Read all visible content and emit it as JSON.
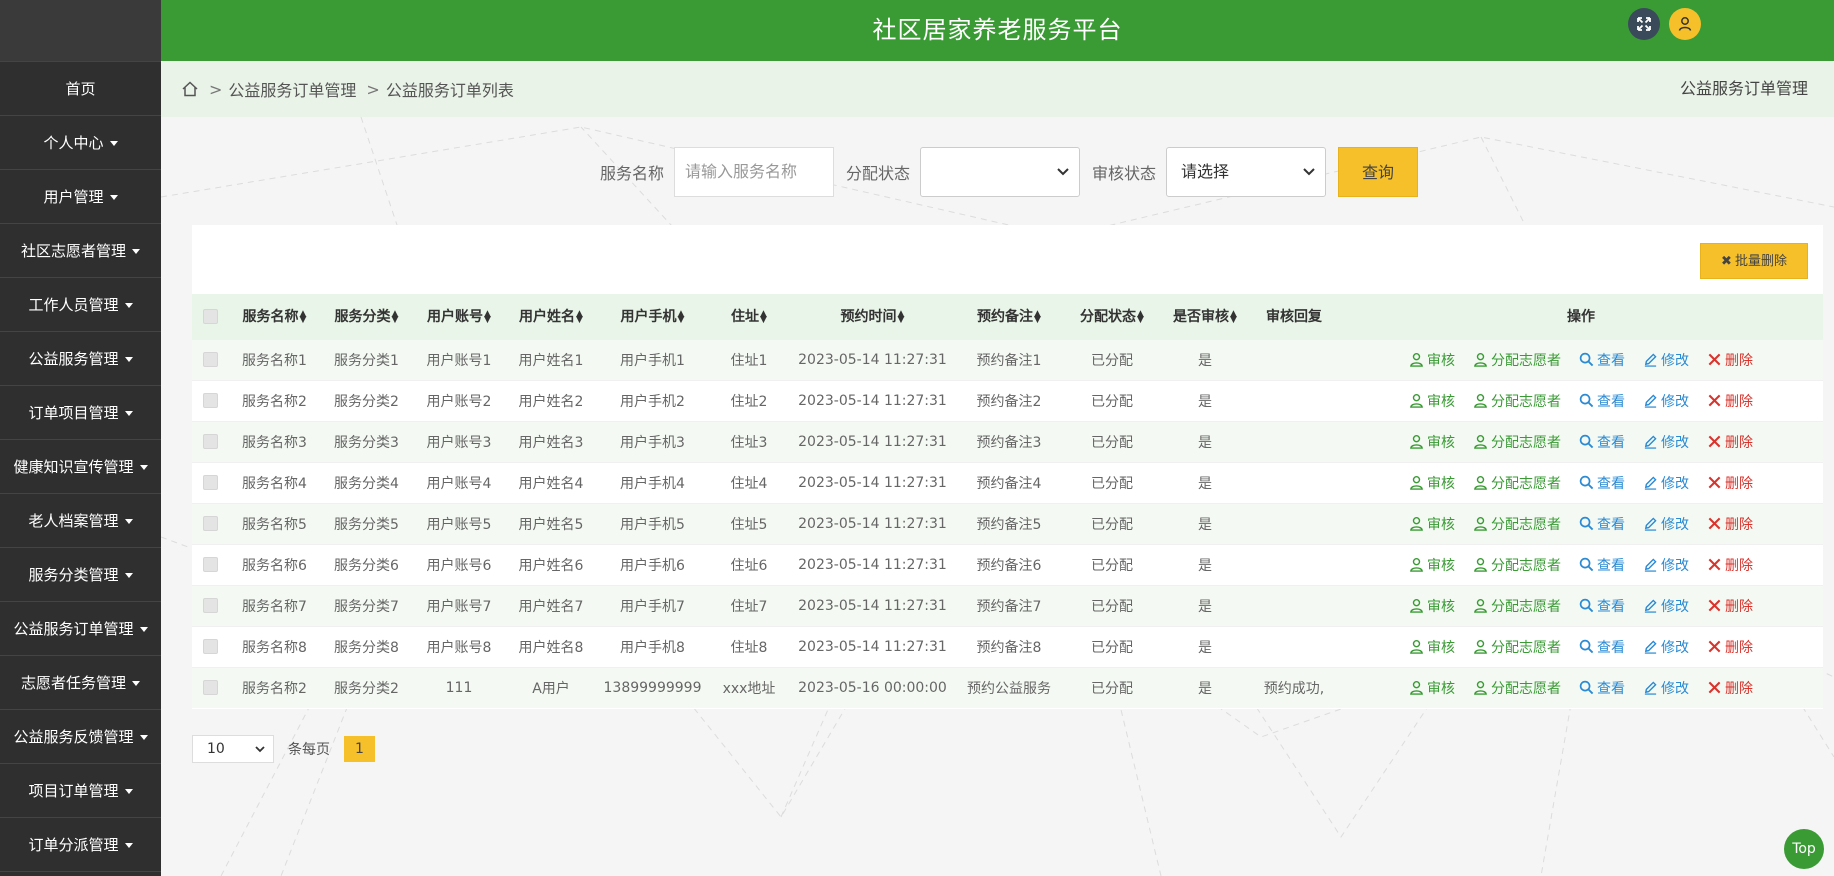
{
  "app": {
    "title": "社区居家养老服务平台"
  },
  "sidebar": {
    "items": [
      {
        "label": "首页",
        "caret": false
      },
      {
        "label": "个人中心",
        "caret": true
      },
      {
        "label": "用户管理",
        "caret": true
      },
      {
        "label": "社区志愿者管理",
        "caret": true
      },
      {
        "label": "工作人员管理",
        "caret": true
      },
      {
        "label": "公益服务管理",
        "caret": true
      },
      {
        "label": "订单项目管理",
        "caret": true
      },
      {
        "label": "健康知识宣传管理",
        "caret": true
      },
      {
        "label": "老人档案管理",
        "caret": true
      },
      {
        "label": "服务分类管理",
        "caret": true
      },
      {
        "label": "公益服务订单管理",
        "caret": true
      },
      {
        "label": "志愿者任务管理",
        "caret": true
      },
      {
        "label": "公益服务反馈管理",
        "caret": true
      },
      {
        "label": "项目订单管理",
        "caret": true
      },
      {
        "label": "订单分派管理",
        "caret": true
      }
    ]
  },
  "breadcrumb": {
    "items": [
      "公益服务订单管理",
      "公益服务订单列表"
    ],
    "right": "公益服务订单管理"
  },
  "search": {
    "name_label": "服务名称",
    "name_placeholder": "请输入服务名称",
    "assign_label": "分配状态",
    "assign_value": "",
    "review_label": "审核状态",
    "review_value": "请选择",
    "query_label": "查询"
  },
  "toolbar": {
    "batch_delete_label": "批量删除"
  },
  "table": {
    "columns": [
      {
        "label": "服务名称",
        "sortable": true
      },
      {
        "label": "服务分类",
        "sortable": true
      },
      {
        "label": "用户账号",
        "sortable": true
      },
      {
        "label": "用户姓名",
        "sortable": true
      },
      {
        "label": "用户手机",
        "sortable": true
      },
      {
        "label": "住址",
        "sortable": true
      },
      {
        "label": "预约时间",
        "sortable": true
      },
      {
        "label": "预约备注",
        "sortable": true
      },
      {
        "label": "分配状态",
        "sortable": true
      },
      {
        "label": "是否审核",
        "sortable": true
      },
      {
        "label": "审核回复",
        "sortable": false
      },
      {
        "label": "操作",
        "sortable": false
      }
    ],
    "rows": [
      [
        "服务名称1",
        "服务分类1",
        "用户账号1",
        "用户姓名1",
        "用户手机1",
        "住址1",
        "2023-05-14 11:27:31",
        "预约备注1",
        "已分配",
        "是",
        ""
      ],
      [
        "服务名称2",
        "服务分类2",
        "用户账号2",
        "用户姓名2",
        "用户手机2",
        "住址2",
        "2023-05-14 11:27:31",
        "预约备注2",
        "已分配",
        "是",
        ""
      ],
      [
        "服务名称3",
        "服务分类3",
        "用户账号3",
        "用户姓名3",
        "用户手机3",
        "住址3",
        "2023-05-14 11:27:31",
        "预约备注3",
        "已分配",
        "是",
        ""
      ],
      [
        "服务名称4",
        "服务分类4",
        "用户账号4",
        "用户姓名4",
        "用户手机4",
        "住址4",
        "2023-05-14 11:27:31",
        "预约备注4",
        "已分配",
        "是",
        ""
      ],
      [
        "服务名称5",
        "服务分类5",
        "用户账号5",
        "用户姓名5",
        "用户手机5",
        "住址5",
        "2023-05-14 11:27:31",
        "预约备注5",
        "已分配",
        "是",
        ""
      ],
      [
        "服务名称6",
        "服务分类6",
        "用户账号6",
        "用户姓名6",
        "用户手机6",
        "住址6",
        "2023-05-14 11:27:31",
        "预约备注6",
        "已分配",
        "是",
        ""
      ],
      [
        "服务名称7",
        "服务分类7",
        "用户账号7",
        "用户姓名7",
        "用户手机7",
        "住址7",
        "2023-05-14 11:27:31",
        "预约备注7",
        "已分配",
        "是",
        ""
      ],
      [
        "服务名称8",
        "服务分类8",
        "用户账号8",
        "用户姓名8",
        "用户手机8",
        "住址8",
        "2023-05-14 11:27:31",
        "预约备注8",
        "已分配",
        "是",
        ""
      ],
      [
        "服务名称2",
        "服务分类2",
        "111",
        "A用户",
        "13899999999",
        "xxx地址",
        "2023-05-16 00:00:00",
        "预约公益服务",
        "已分配",
        "是",
        "预约成功,"
      ]
    ],
    "actions": [
      "审核",
      "分配志愿者",
      "查看",
      "修改",
      "删除"
    ]
  },
  "pagination": {
    "page_size": "10",
    "per_page_label": "条每页",
    "current_page": "1"
  },
  "back_to_top": "Top",
  "colors": {
    "primary": "#3a9b35",
    "accent": "#f5c02a",
    "sidebar": "#2f2f2f",
    "danger": "#d9332c",
    "link": "#2a8ad4"
  },
  "icons": {
    "header": [
      "expand-icon",
      "user-icon"
    ],
    "breadcrumb": "home-icon",
    "actions": [
      "user-check-icon",
      "user-assign-icon",
      "search-icon",
      "edit-icon",
      "close-icon"
    ]
  }
}
